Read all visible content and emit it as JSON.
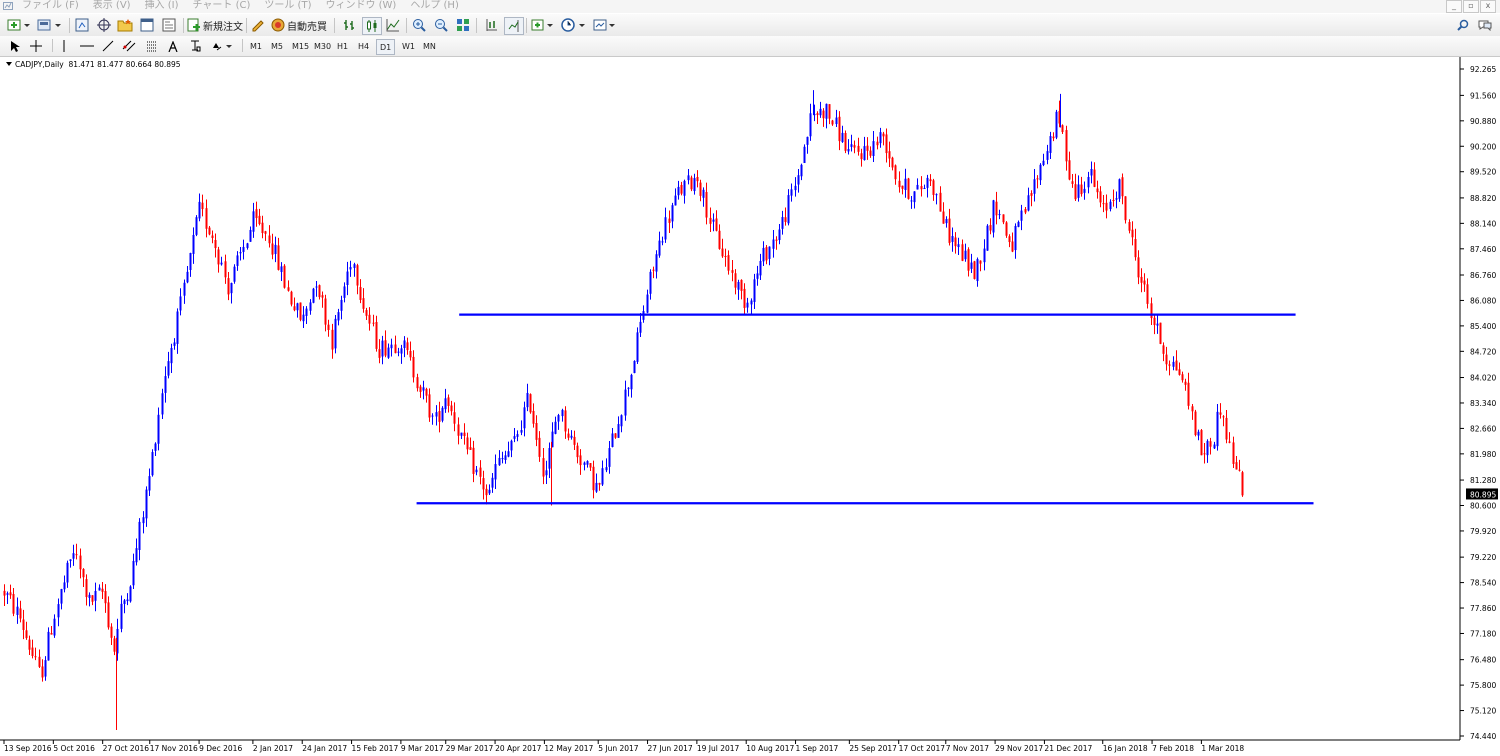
{
  "menu": {
    "items": [
      "ファイル (F)",
      "表示 (V)",
      "挿入 (I)",
      "チャート (C)",
      "ツール (T)",
      "ウィンドウ (W)",
      "ヘルプ (H)"
    ],
    "window_controls": [
      "_",
      "▫",
      "x"
    ]
  },
  "toolbar": {
    "new_order_label": "新規注文",
    "auto_trade_label": "自動売買",
    "timeframes": [
      "M1",
      "M5",
      "M15",
      "M30",
      "H1",
      "H4",
      "D1",
      "W1",
      "MN"
    ],
    "active_timeframe": "D1"
  },
  "chart_header": {
    "symbol_period": "CADJPY,Daily",
    "ohlc": "81.471 81.477 80.664 80.895"
  },
  "price_axis": {
    "ticks": [
      "92.265",
      "91.560",
      "90.880",
      "90.200",
      "89.520",
      "88.820",
      "88.140",
      "87.460",
      "86.760",
      "86.080",
      "85.400",
      "84.720",
      "84.020",
      "83.340",
      "82.660",
      "81.980",
      "81.280",
      "80.600",
      "79.920",
      "79.220",
      "78.540",
      "77.860",
      "77.180",
      "76.480",
      "75.800",
      "75.120",
      "74.440"
    ],
    "current_price": "80.895"
  },
  "time_axis": {
    "ticks": [
      "13 Sep 2016",
      "5 Oct 2016",
      "27 Oct 2016",
      "17 Nov 2016",
      "9 Dec 2016",
      "2 Jan 2017",
      "24 Jan 2017",
      "15 Feb 2017",
      "9 Mar 2017",
      "29 Mar 2017",
      "20 Apr 2017",
      "12 May 2017",
      "5 Jun 2017",
      "27 Jun 2017",
      "19 Jul 2017",
      "10 Aug 2017",
      "1 Sep 2017",
      "25 Sep 2017",
      "17 Oct 2017",
      "7 Nov 2017",
      "29 Nov 2017",
      "21 Dec 2017",
      "16 Jan 2018",
      "7 Feb 2018",
      "1 Mar 2018"
    ]
  },
  "chart_data": {
    "type": "candlestick",
    "symbol": "CADJPY",
    "timeframe": "Daily",
    "ylim": [
      74.44,
      92.265
    ],
    "bull_color": "#0000ff",
    "bear_color": "#ff0000",
    "horizontal_lines": [
      {
        "price": 85.7,
        "from": "4 Apr 2017",
        "to": "12 Apr 2018",
        "color": "#0000ff"
      },
      {
        "price": 80.66,
        "from": "16 Mar 2017",
        "to": "20 Apr 2018",
        "color": "#0000ff"
      }
    ],
    "close_path": [
      [
        "13 Sep 2016",
        78.3
      ],
      [
        "20 Sep 2016",
        77.6
      ],
      [
        "29 Sep 2016",
        76.0
      ],
      [
        "5 Oct 2016",
        77.6
      ],
      [
        "14 Oct 2016",
        79.4
      ],
      [
        "21 Oct 2016",
        78.0
      ],
      [
        "27 Oct 2016",
        78.3
      ],
      [
        "1 Nov 2016",
        76.7
      ],
      [
        "4 Nov 2016",
        77.8
      ],
      [
        "9 Nov 2016",
        78.8
      ],
      [
        "17 Nov 2016",
        81.5
      ],
      [
        "23 Nov 2016",
        84.0
      ],
      [
        "1 Dec 2016",
        86.0
      ],
      [
        "9 Dec 2016",
        88.5
      ],
      [
        "15 Dec 2016",
        87.8
      ],
      [
        "22 Dec 2016",
        86.4
      ],
      [
        "2 Jan 2017",
        88.2
      ],
      [
        "9 Jan 2017",
        87.8
      ],
      [
        "18 Jan 2017",
        86.2
      ],
      [
        "24 Jan 2017",
        85.5
      ],
      [
        "30 Jan 2017",
        86.7
      ],
      [
        "6 Feb 2017",
        85.0
      ],
      [
        "15 Feb 2017",
        87.3
      ],
      [
        "21 Feb 2017",
        85.8
      ],
      [
        "27 Feb 2017",
        84.8
      ],
      [
        "9 Mar 2017",
        85.0
      ],
      [
        "16 Mar 2017",
        84.0
      ],
      [
        "24 Mar 2017",
        82.8
      ],
      [
        "29 Mar 2017",
        83.6
      ],
      [
        "6 Apr 2017",
        82.2
      ],
      [
        "17 Apr 2017",
        80.8
      ],
      [
        "20 Apr 2017",
        81.6
      ],
      [
        "28 Apr 2017",
        82.2
      ],
      [
        "5 May 2017",
        83.5
      ],
      [
        "12 May 2017",
        81.4
      ],
      [
        "18 May 2017",
        83.2
      ],
      [
        "25 May 2017",
        82.2
      ],
      [
        "5 Jun 2017",
        81.0
      ],
      [
        "12 Jun 2017",
        82.5
      ],
      [
        "20 Jun 2017",
        84.3
      ],
      [
        "27 Jun 2017",
        86.4
      ],
      [
        "4 Jul 2017",
        88.0
      ],
      [
        "11 Jul 2017",
        89.0
      ],
      [
        "19 Jul 2017",
        89.4
      ],
      [
        "26 Jul 2017",
        88.0
      ],
      [
        "4 Aug 2017",
        86.7
      ],
      [
        "10 Aug 2017",
        86.0
      ],
      [
        "17 Aug 2017",
        87.2
      ],
      [
        "25 Aug 2017",
        88.0
      ],
      [
        "1 Sep 2017",
        89.2
      ],
      [
        "8 Sep 2017",
        91.0
      ],
      [
        "14 Sep 2017",
        91.2
      ],
      [
        "20 Sep 2017",
        90.6
      ],
      [
        "25 Sep 2017",
        90.0
      ],
      [
        "3 Oct 2017",
        90.1
      ],
      [
        "10 Oct 2017",
        90.5
      ],
      [
        "17 Oct 2017",
        89.2
      ],
      [
        "24 Oct 2017",
        88.9
      ],
      [
        "31 Oct 2017",
        89.4
      ],
      [
        "7 Nov 2017",
        88.0
      ],
      [
        "14 Nov 2017",
        87.3
      ],
      [
        "20 Nov 2017",
        86.8
      ],
      [
        "29 Nov 2017",
        88.7
      ],
      [
        "6 Dec 2017",
        87.5
      ],
      [
        "13 Dec 2017",
        88.6
      ],
      [
        "21 Dec 2017",
        90.0
      ],
      [
        "27 Dec 2017",
        91.0
      ],
      [
        "3 Jan 2018",
        88.9
      ],
      [
        "10 Jan 2018",
        89.5
      ],
      [
        "16 Jan 2018",
        88.4
      ],
      [
        "23 Jan 2018",
        89.2
      ],
      [
        "30 Jan 2018",
        87.3
      ],
      [
        "7 Feb 2018",
        85.6
      ],
      [
        "13 Feb 2018",
        84.6
      ],
      [
        "20 Feb 2018",
        84.1
      ],
      [
        "1 Mar 2018",
        82.0
      ],
      [
        "6 Mar 2018",
        82.3
      ],
      [
        "9 Mar 2018",
        83.3
      ],
      [
        "14 Mar 2018",
        82.0
      ],
      [
        "20 Mar 2018",
        80.9
      ]
    ],
    "extreme_wicks": [
      {
        "date": "2 Nov 2016",
        "low": 74.6
      },
      {
        "date": "9 Sep 2017",
        "high": 91.7
      },
      {
        "date": "28 Dec 2017",
        "high": 91.6
      },
      {
        "date": "15 May 2017",
        "low": 80.6
      }
    ]
  }
}
